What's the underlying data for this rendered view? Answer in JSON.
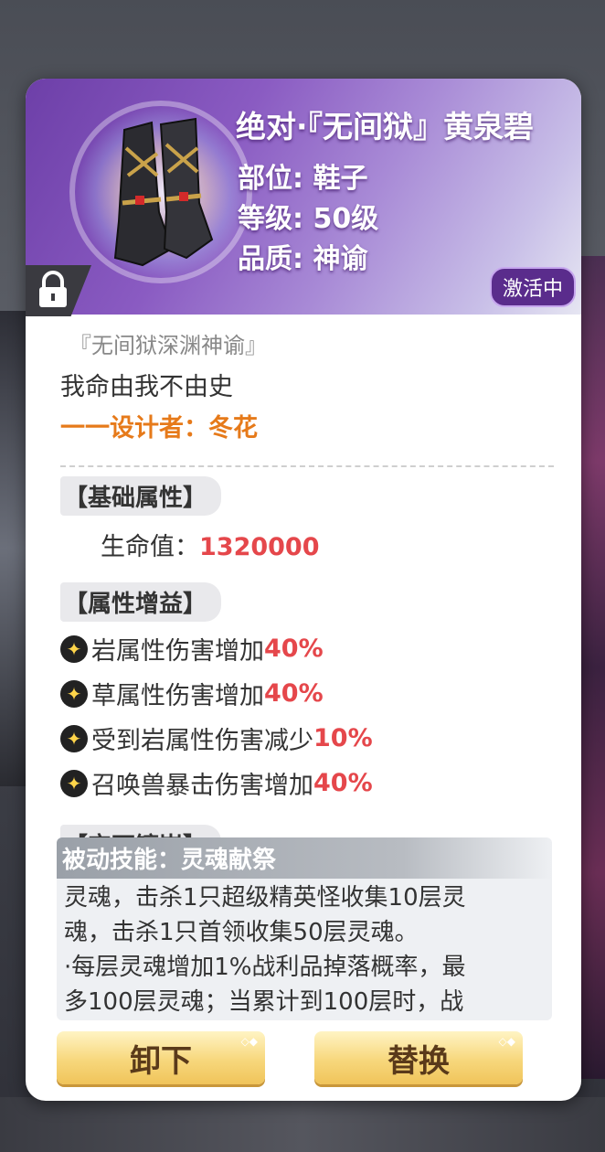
{
  "item": {
    "title": "绝对·『无间狱』黄泉碧",
    "slot": "部位: 鞋子",
    "level": "等级: 50级",
    "quality": "品质: 神谕",
    "status_badge": "激活中"
  },
  "flavor": {
    "quote": "『无间狱深渊神谕』",
    "motto": "我命由我不由史",
    "designer": "一一设计者：冬花"
  },
  "base_stats": {
    "header": "【基础属性】",
    "hp_label": "生命值：",
    "hp_value": "1320000"
  },
  "bonuses": {
    "header": "【属性增益】",
    "items": [
      {
        "text": "岩属性伤害增加",
        "value": "40%"
      },
      {
        "text": "草属性伤害增加",
        "value": "40%"
      },
      {
        "text": "受到岩属性伤害减少",
        "value": "10%"
      },
      {
        "text": "召唤兽暴击伤害增加",
        "value": "40%"
      }
    ]
  },
  "gems": {
    "header": "【宝石镶嵌】"
  },
  "skill": {
    "header": "被动技能：灵魂献祭",
    "line1": "灵魂，击杀1只超级精英怪收集10层灵",
    "line2": "魂，击杀1只首领收集50层灵魂。",
    "line3": "·每层灵魂增加1%战利品掉落概率，最",
    "line4": "多100层灵魂；当累计到100层时，战"
  },
  "buttons": {
    "unequip": "卸下",
    "replace": "替换"
  },
  "icons": {
    "lock": "lock-icon",
    "bonus": "sparkle-icon"
  },
  "colors": {
    "accent_red": "#e5474b",
    "designer_orange": "#e67a1a",
    "badge_purple": "#5a2c8c"
  }
}
